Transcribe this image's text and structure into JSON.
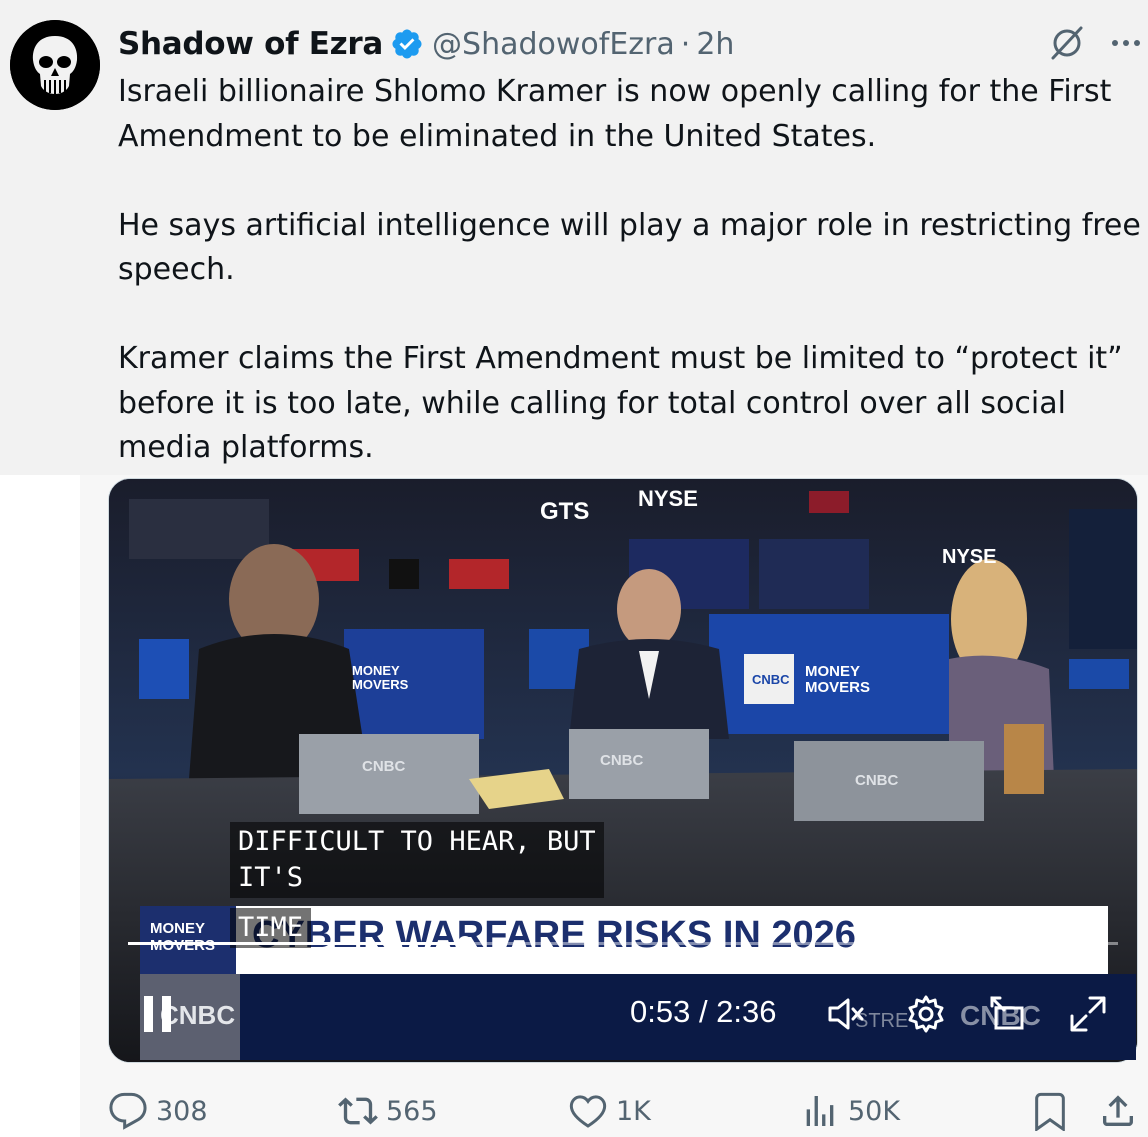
{
  "tweet": {
    "display_name": "Shadow of Ezra",
    "handle": "@ShadowofEzra",
    "separator": "·",
    "time": "2h",
    "verified": true,
    "text_lines": [
      "Israeli billionaire Shlomo Kramer is now openly calling for the First",
      "Amendment to be eliminated in the United States.",
      "",
      "He says artificial intelligence will play a major role in restricting free",
      "speech.",
      "",
      "Kramer claims the First Amendment must be limited to “protect it”",
      "before it is too late, while calling for total control over all social",
      "media platforms."
    ]
  },
  "video": {
    "signage": {
      "nyse": "NYSE",
      "gts": "GTS",
      "money_movers_line1": "MONEY",
      "money_movers_line2": "MOVERS",
      "cnbc": "CNBC"
    },
    "caption_lines": [
      "DIFFICULT TO HEAR, BUT",
      "IT'S"
    ],
    "caption_partial": "TIME",
    "lower_third_tag_line1": "MONEY",
    "lower_third_tag_line2": "MOVERS",
    "headline": "CYBER WARFARE RISKS IN 2026",
    "ticker_fragment": "STRE",
    "current_time": "0:53",
    "duration": "2:36",
    "time_readout": "0:53 / 2:36",
    "progress_fraction": 0.34,
    "muted": true
  },
  "actions": {
    "replies": "308",
    "reposts": "565",
    "likes": "1K",
    "views": "50K"
  },
  "colors": {
    "verified_blue": "#1d9bf0",
    "muted_text": "#536471",
    "top_bg": "#f2f2f2"
  },
  "icons": {
    "verified": "verified-badge-icon",
    "grok": "grok-icon",
    "more": "more-icon",
    "reply": "reply-icon",
    "repost": "repost-icon",
    "like": "heart-icon",
    "views": "views-icon",
    "bookmark": "bookmark-icon",
    "share": "share-icon"
  }
}
